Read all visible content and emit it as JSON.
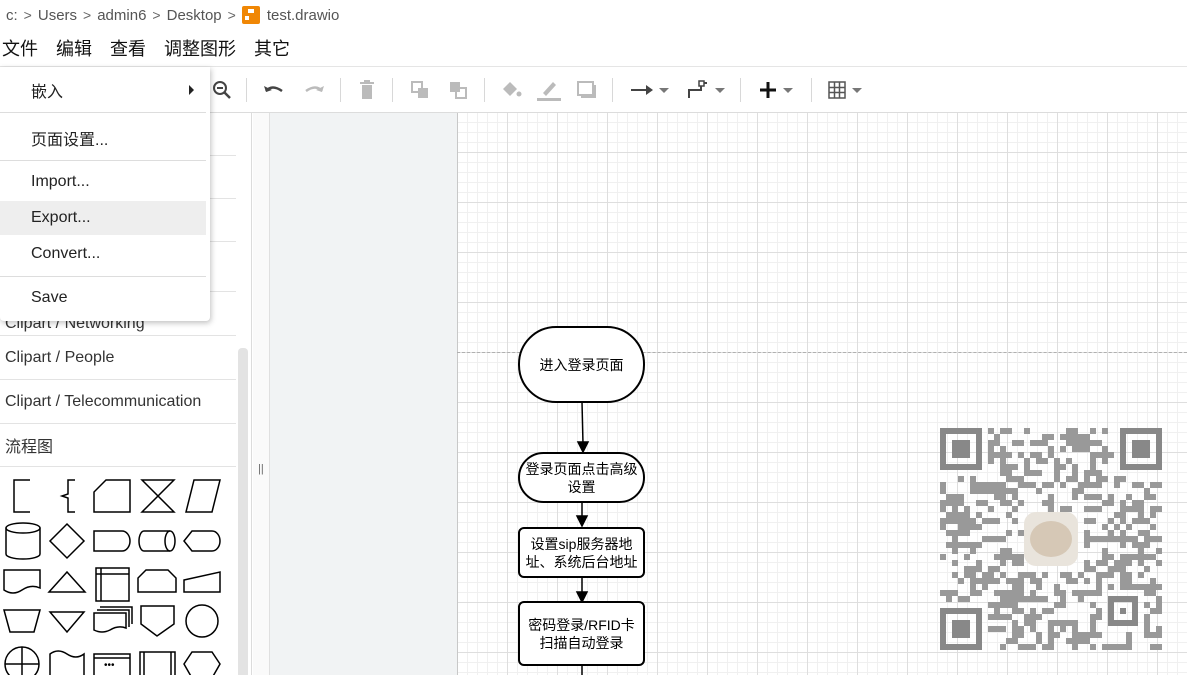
{
  "breadcrumb": {
    "drive": "c:",
    "parts": [
      "Users",
      "admin6",
      "Desktop"
    ],
    "file": "test.drawio",
    "file_icon": "drawio-file-icon"
  },
  "menubar": {
    "items": [
      "文件",
      "编辑",
      "查看",
      "调整图形",
      "其它"
    ]
  },
  "toolbar": {
    "icons": [
      "zoom-out-icon",
      "undo-icon",
      "redo-icon",
      "delete-icon",
      "to-front-icon",
      "to-back-icon",
      "fill-color-icon",
      "line-color-icon",
      "shadow-icon",
      "connection-icon",
      "waypoints-icon",
      "insert-icon",
      "table-icon"
    ]
  },
  "file_menu": {
    "items": [
      {
        "label": "嵌入",
        "submenu": true
      },
      {
        "label": "页面设置..."
      },
      {
        "label": "Import..."
      },
      {
        "label": "Export...",
        "highlighted": true
      },
      {
        "label": "Convert..."
      },
      {
        "label": "Save"
      }
    ]
  },
  "sidebar": {
    "sections": [
      "Clipart / Networking",
      "Clipart / People",
      "Clipart / Telecommunication",
      "流程图"
    ],
    "shapes": [
      "annotation-1",
      "annotation-2",
      "card",
      "collate",
      "data",
      "database",
      "decision",
      "delay",
      "direct-data",
      "display",
      "document",
      "extract",
      "internal-storage",
      "loop-limit",
      "manual-input",
      "manual-operation",
      "merge",
      "multi-document",
      "off-page-reference",
      "on-page-reference",
      "or",
      "paper-tape",
      "predefined-process",
      "process",
      "preparation"
    ]
  },
  "gutter": {
    "handle": "||"
  },
  "diagram": {
    "nodes": [
      {
        "text": "进入登录页面",
        "shape": "terminator"
      },
      {
        "text": "登录页面点击高级设置",
        "shape": "terminator"
      },
      {
        "text": "设置sip服务器地址、系统后台地址",
        "shape": "process"
      },
      {
        "text": "密码登录/RFID卡扫描自动登录",
        "shape": "process"
      }
    ]
  }
}
